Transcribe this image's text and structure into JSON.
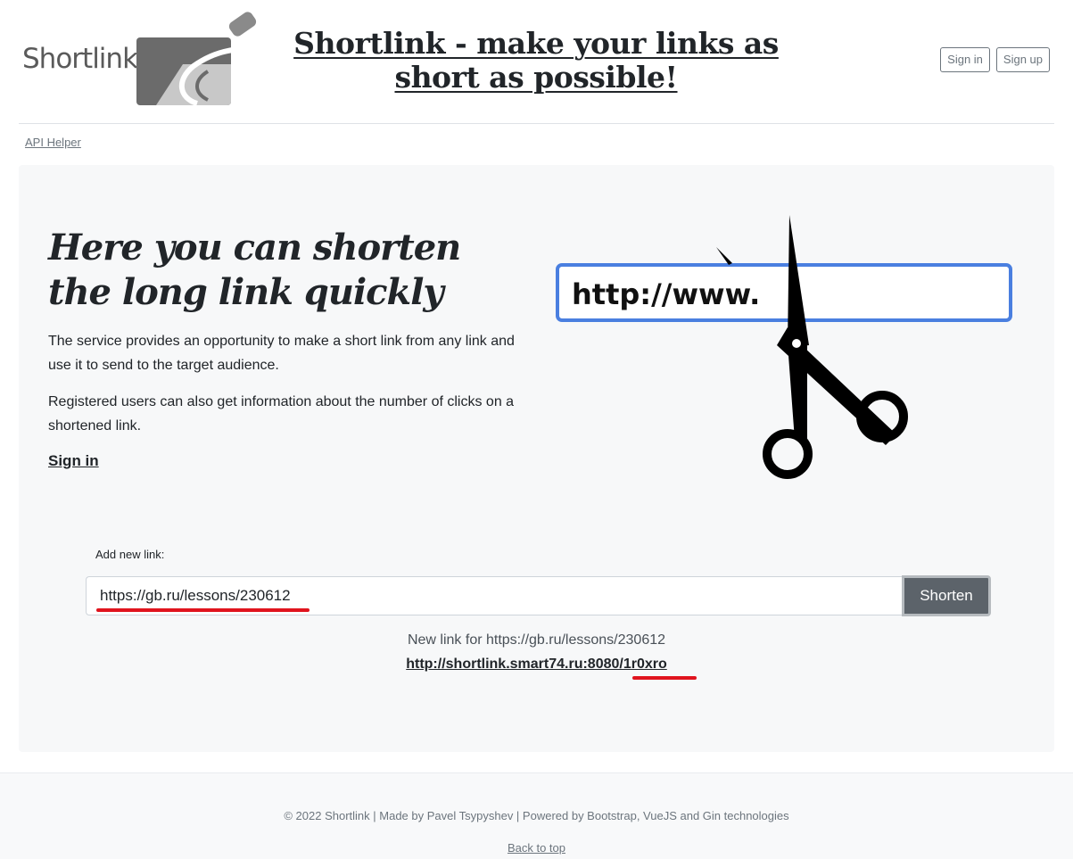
{
  "header": {
    "logo_text": "Shortlink",
    "title": "Shortlink - make your links as short as possible!",
    "sign_in": "Sign in",
    "sign_up": "Sign up"
  },
  "nav": {
    "api_helper": "API Helper"
  },
  "hero": {
    "heading": "Here you can shorten the long link quickly",
    "paragraph1": "The service provides an opportunity to make a short link from any link and use it to send to the target audience.",
    "paragraph2": "Registered users can also get information about the number of clicks on a shortened link.",
    "sign_in_link": "Sign in",
    "illustration_text": "http://www."
  },
  "form": {
    "label": "Add new link:",
    "input_value": "https://gb.ru/lessons/230612",
    "button": "Shorten"
  },
  "result": {
    "label": "New link for https://gb.ru/lessons/230612",
    "short_link": "http://shortlink.smart74.ru:8080/1r0xro"
  },
  "footer": {
    "text": "© 2022 Shortlink | Made by Pavel Tsypyshev | Powered by Bootstrap, VueJS and Gin technologies",
    "back_to_top": "Back to top"
  },
  "colors": {
    "accent_blue": "#4a7fe0",
    "highlight_red": "#e0141e",
    "button_gray": "#5c636a",
    "hero_bg": "#f7f8f9"
  }
}
